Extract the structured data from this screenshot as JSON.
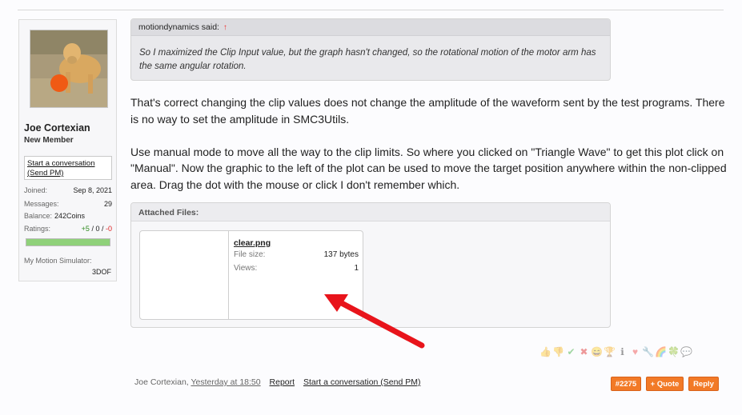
{
  "sidebar": {
    "username": "Joe Cortexian",
    "user_title": "New Member",
    "conversation_label": "Start a conversation (Send PM)",
    "stats": {
      "joined_label": "Joined:",
      "joined_value": "Sep 8, 2021",
      "messages_label": "Messages:",
      "messages_value": "29",
      "balance_label": "Balance:",
      "balance_value": "242Coins",
      "ratings_label": "Ratings:",
      "ratings_pos": "+5",
      "ratings_sep1": " / ",
      "ratings_neutral": "0",
      "ratings_sep2": " / ",
      "ratings_neg": "-0",
      "rating_fill": 1.0
    },
    "motion_sim_label": "My Motion Simulator:",
    "motion_sim_value": "3DOF"
  },
  "quote": {
    "author": "motiondynamics said:",
    "up_icon": "↑",
    "text": "So I maximized the Clip Input value, but the graph hasn't changed, so the rotational motion of the motor arm has the same angular rotation."
  },
  "post": {
    "paragraph1": "That's correct changing the clip values does not change the amplitude of the waveform sent by the test programs. There is no way to set the amplitude in SMC3Utils.",
    "paragraph2": "Use manual mode to move all the way to the clip limits. So where you clicked on \"Triangle Wave\" to get this plot click on \"Manual\". Now the graphic to the left of the plot can be used to move the target position anywhere within the non-clipped area. Drag the dot with the mouse or click I don't remember which."
  },
  "attachments": {
    "header": "Attached Files:",
    "file": {
      "name": "clear.png",
      "size_label": "File size:",
      "size_value": "137 bytes",
      "views_label": "Views:",
      "views_value": "1"
    }
  },
  "reactions": [
    "like-icon",
    "dislike-icon",
    "agree-icon",
    "disagree-icon",
    "funny-icon",
    "winner-icon",
    "informative-icon",
    "love-icon",
    "useful-icon",
    "creative-icon",
    "optimistic-icon",
    "friendly-icon"
  ],
  "footer": {
    "author": "Joe Cortexian,",
    "time": "Yesterday at 18:50",
    "report": "Report",
    "conversation": "Start a conversation (Send PM)",
    "post_number": "#2275",
    "quote_label": "+ Quote",
    "reply_label": "Reply"
  },
  "colors": {
    "accent_button": "#f27a27",
    "rating_bar": "#8fd17a",
    "arrow": "#e8141b"
  }
}
